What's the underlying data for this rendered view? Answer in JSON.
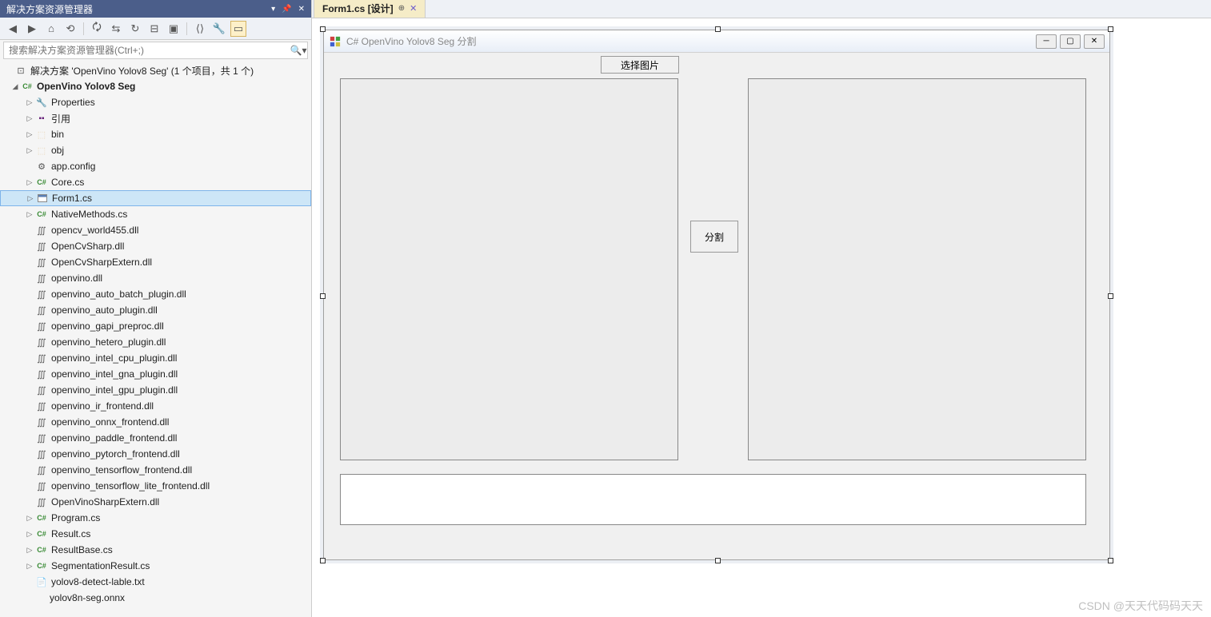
{
  "solution_explorer": {
    "title": "解决方案资源管理器",
    "search_placeholder": "搜索解决方案资源管理器(Ctrl+;)",
    "solution_label": "解决方案 'OpenVino Yolov8 Seg' (1 个项目，共 1 个)",
    "project_name": "OpenVino Yolov8 Seg",
    "items": {
      "properties": "Properties",
      "references": "引用",
      "bin": "bin",
      "obj": "obj",
      "app_config": "app.config",
      "core_cs": "Core.cs",
      "form1_cs": "Form1.cs",
      "native_methods": "NativeMethods.cs",
      "opencv_world": "opencv_world455.dll",
      "opencvsharp": "OpenCvSharp.dll",
      "opencvsharp_extern": "OpenCvSharpExtern.dll",
      "openvino": "openvino.dll",
      "openvino_auto_batch": "openvino_auto_batch_plugin.dll",
      "openvino_auto": "openvino_auto_plugin.dll",
      "openvino_gapi": "openvino_gapi_preproc.dll",
      "openvino_hetero": "openvino_hetero_plugin.dll",
      "openvino_intel_cpu": "openvino_intel_cpu_plugin.dll",
      "openvino_intel_gna": "openvino_intel_gna_plugin.dll",
      "openvino_intel_gpu": "openvino_intel_gpu_plugin.dll",
      "openvino_ir": "openvino_ir_frontend.dll",
      "openvino_onnx": "openvino_onnx_frontend.dll",
      "openvino_paddle": "openvino_paddle_frontend.dll",
      "openvino_pytorch": "openvino_pytorch_frontend.dll",
      "openvino_tensorflow": "openvino_tensorflow_frontend.dll",
      "openvino_tensorflow_lite": "openvino_tensorflow_lite_frontend.dll",
      "openvinosharp_extern": "OpenVinoSharpExtern.dll",
      "program_cs": "Program.cs",
      "result_cs": "Result.cs",
      "resultbase_cs": "ResultBase.cs",
      "segmentation_result": "SegmentationResult.cs",
      "yolov8_detect_label": "yolov8-detect-lable.txt",
      "yolov8n_seg": "yolov8n-seg.onnx"
    }
  },
  "tab": {
    "label": "Form1.cs [设计]"
  },
  "form": {
    "title": "C# OpenVino Yolov8 Seg 分割",
    "select_image_btn": "选择图片",
    "segment_btn": "分割"
  },
  "watermark": "CSDN @天天代码码天天"
}
